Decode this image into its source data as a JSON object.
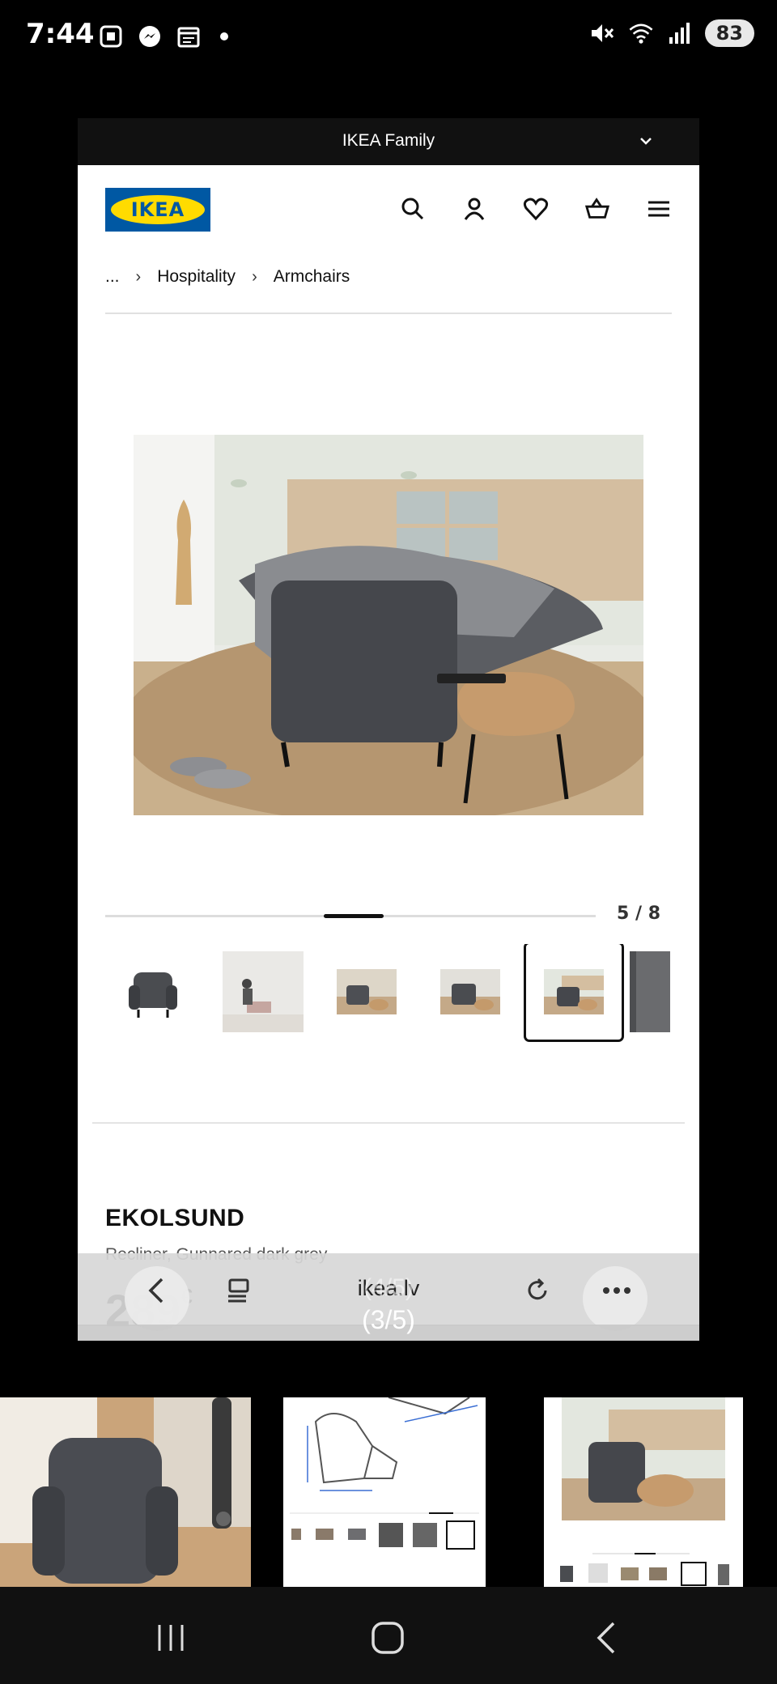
{
  "status_bar": {
    "time": "7:44",
    "battery": "83",
    "left_icons": [
      "screenshot-icon",
      "messenger-icon",
      "calendar-icon",
      "dot-icon"
    ],
    "right_icons": [
      "mute-icon",
      "wifi-icon",
      "signal-icon"
    ]
  },
  "family_bar": {
    "label": "IKEA Family"
  },
  "header": {
    "logo_text": "IKEA"
  },
  "breadcrumb": {
    "items": [
      "...",
      "Hospitality",
      "Armchairs"
    ]
  },
  "gallery": {
    "counter": "5 / 8",
    "current": 5,
    "total": 8,
    "selected_thumb": 5
  },
  "product": {
    "name": "EKOLSUND",
    "description": "Recliner, Gunnared dark grey",
    "price": "289",
    "currency": "€"
  },
  "browser": {
    "url": "ikea.lv",
    "tab_indicator_faded": "(4/5)",
    "tab_indicator": "(3/5)"
  },
  "colors": {
    "ikea_blue": "#0058a3",
    "ikea_yellow": "#ffdb00"
  }
}
